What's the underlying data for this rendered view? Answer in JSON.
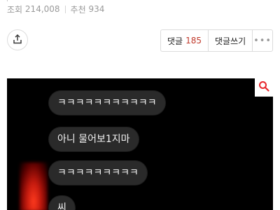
{
  "stats": {
    "views_label": "조회",
    "views_value": "214,008",
    "recommend_label": "추천",
    "recommend_value": "934"
  },
  "actions": {
    "comment_label": "댓글",
    "comment_count": "185",
    "write_comment_label": "댓글쓰기",
    "more_label": "•••"
  },
  "icons": {
    "share": "share-icon",
    "zoom": "search-icon",
    "accent": "#e8262b"
  },
  "chat": {
    "messages": [
      "ㅋㅋㅋㅋㅋㅋㅋㅋㅋㅋㅋ",
      "아니 물어보1지마",
      "ㅋㅋㅋㅋㅋㅋㅋㅋㅋ",
      "씨"
    ]
  }
}
